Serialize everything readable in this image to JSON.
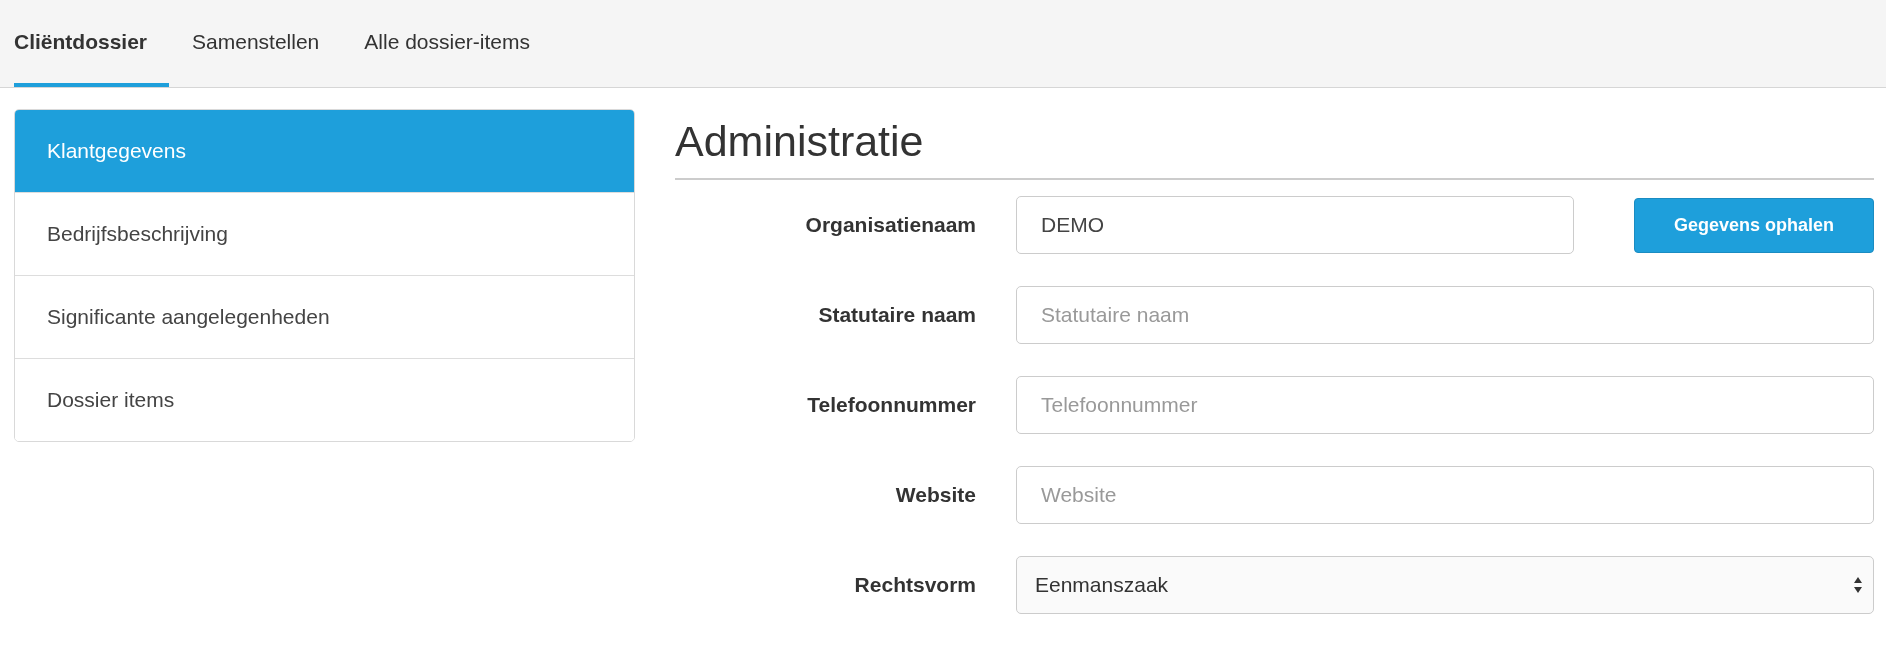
{
  "tabs": [
    {
      "label": "Cliëntdossier",
      "selected": true
    },
    {
      "label": "Samenstellen",
      "selected": false
    },
    {
      "label": "Alle dossier-items",
      "selected": false
    }
  ],
  "sidebar": {
    "items": [
      {
        "label": "Klantgegevens",
        "selected": true
      },
      {
        "label": "Bedrijfsbeschrijving",
        "selected": false
      },
      {
        "label": "Significante aangelegenheden",
        "selected": false
      },
      {
        "label": "Dossier items",
        "selected": false
      }
    ]
  },
  "section_title": "Administratie",
  "form": {
    "fields": [
      {
        "kind": "text",
        "label": "Organisatienaam",
        "value": "DEMO",
        "button": "Gegevens ophalen"
      },
      {
        "kind": "text",
        "label": "Statutaire naam",
        "placeholder": "Statutaire naam"
      },
      {
        "kind": "text",
        "label": "Telefoonnummer",
        "placeholder": "Telefoonnummer"
      },
      {
        "kind": "text",
        "label": "Website",
        "placeholder": "Website"
      },
      {
        "kind": "select",
        "label": "Rechtsvorm",
        "value": "Eenmanszaak"
      }
    ]
  }
}
